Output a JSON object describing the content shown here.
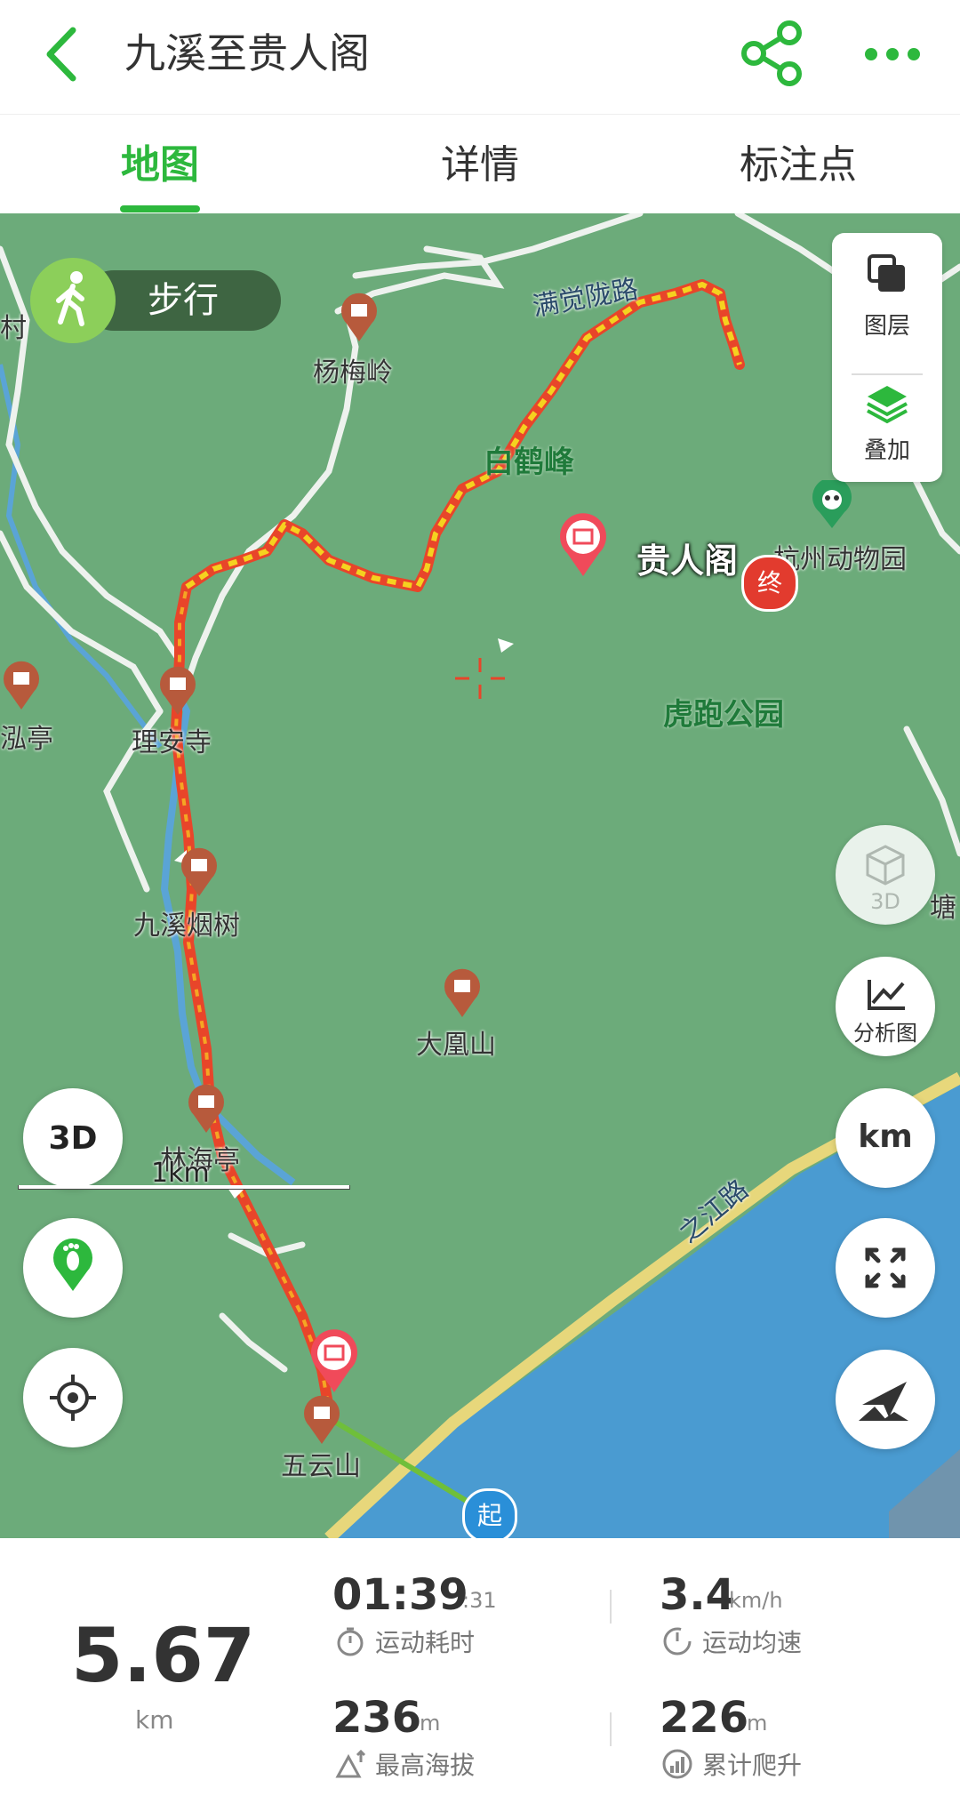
{
  "header": {
    "title": "九溪至贵人阁"
  },
  "tabs": [
    {
      "label": "地图",
      "active": true
    },
    {
      "label": "详情",
      "active": false
    },
    {
      "label": "标注点",
      "active": false
    }
  ],
  "map": {
    "mode_label": "步行",
    "layer_panel": {
      "layers_label": "图层",
      "overlay_label": "叠加"
    },
    "right_buttons": {
      "three_d_label": "3D",
      "analysis_label": "分析图",
      "km_label": "km"
    },
    "places": {
      "yangmeiling": "杨梅岭",
      "liansi": "理安寺",
      "jiuxi_yanshu": "九溪烟树",
      "linhaiting": "林海亭",
      "dahuangshan": "大凰山",
      "wuyunshan": "五云山",
      "cun_partial": "村",
      "hongting_partial": "泓亭",
      "zoo": "杭州动物园",
      "tang_partial": "塘"
    },
    "green_areas": {
      "baihefeng": "白鹤峰",
      "hupao_park": "虎跑公园"
    },
    "roads": {
      "manjuelong": "满觉陇路",
      "zhijiang": "之江路"
    },
    "destination_label": "贵人阁",
    "start_marker": "起",
    "end_marker": "终",
    "scale_label": "1km",
    "colors": {
      "brand_green": "#2db83d",
      "map_green": "#6cab7a",
      "water_blue": "#4a9bd1",
      "track_red": "#e8452a",
      "track_yellow": "#f5d21f"
    }
  },
  "stats": {
    "distance_value": "5.67",
    "distance_unit": "km",
    "duration_value": "01:39",
    "duration_seconds": ":31",
    "duration_label": "运动耗时",
    "avg_speed_value": "3.4",
    "avg_speed_unit": "km/h",
    "avg_speed_label": "运动均速",
    "max_alt_value": "236",
    "max_alt_unit": "m",
    "max_alt_label": "最高海拔",
    "climb_value": "226",
    "climb_unit": "m",
    "climb_label": "累计爬升"
  }
}
